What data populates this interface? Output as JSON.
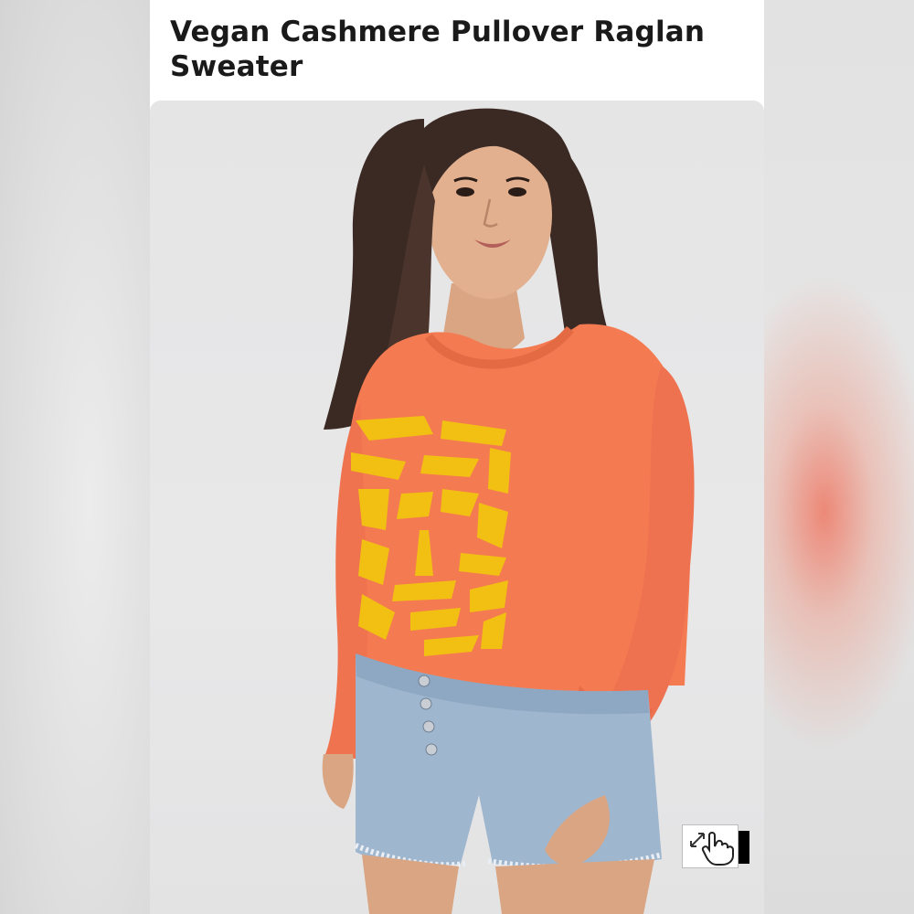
{
  "product": {
    "title": "Vegan Cashmere Pullover Raglan Sweater"
  },
  "image": {
    "subject": "product-photo",
    "icon": "tap-to-zoom-hand-icon"
  },
  "colors": {
    "sweater": "#f47a52",
    "tiger": "#f2c012",
    "denim": "#9fb6cf",
    "backdrop": "#e5e5e6"
  }
}
